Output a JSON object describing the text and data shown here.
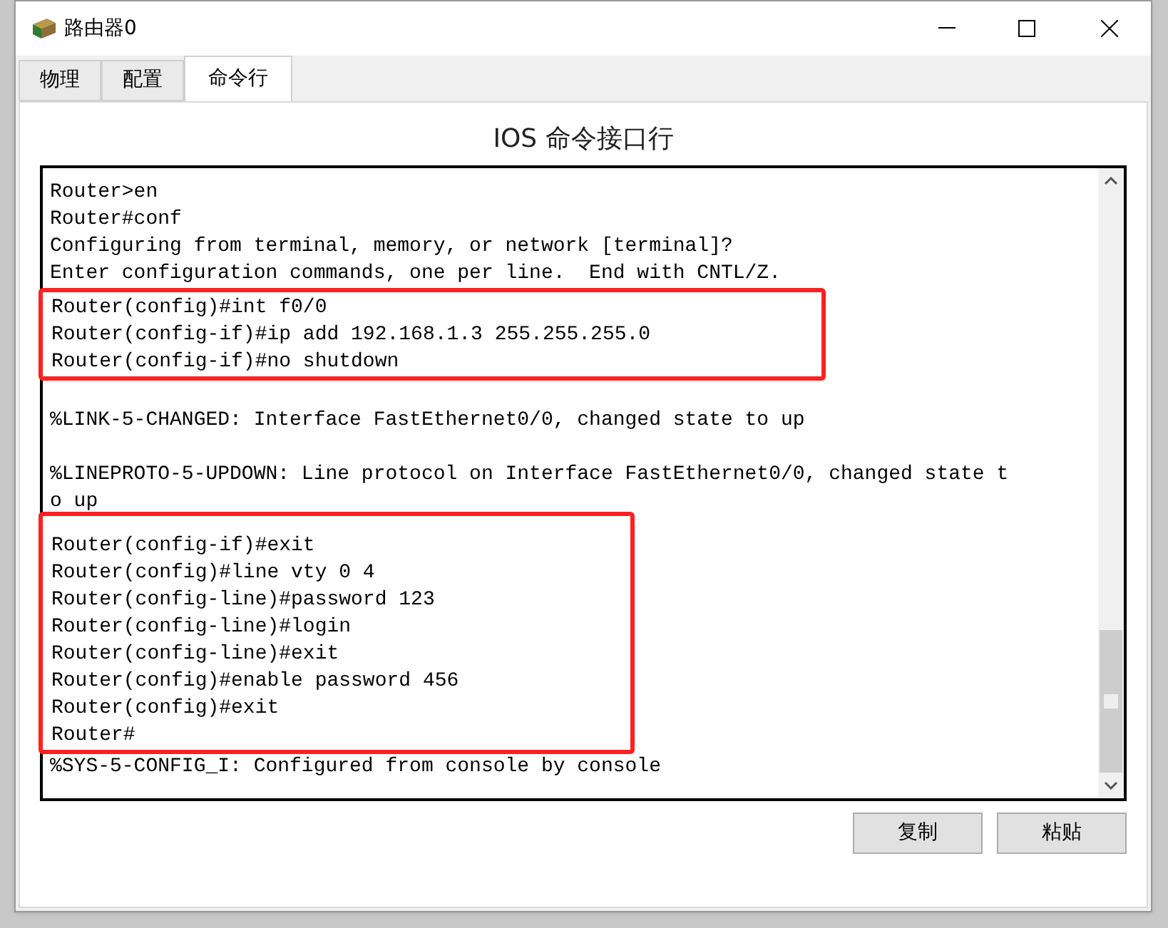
{
  "window": {
    "title": "路由器0"
  },
  "tabs": [
    {
      "label": "物理",
      "selected": false
    },
    {
      "label": "配置",
      "selected": false
    },
    {
      "label": "命令行",
      "selected": true
    }
  ],
  "heading": "IOS 命令接口行",
  "terminal": {
    "blocks": [
      {
        "highlighted": false,
        "gap_before": false,
        "lines": [
          "Router>en",
          "Router#conf",
          "Configuring from terminal, memory, or network [terminal]?",
          "Enter configuration commands, one per line.  End with CNTL/Z."
        ]
      },
      {
        "highlighted": true,
        "gap_before": false,
        "lines": [
          "Router(config)#int f0/0",
          "Router(config-if)#ip add 192.168.1.3 255.255.255.0",
          "Router(config-if)#no shutdown"
        ]
      },
      {
        "highlighted": false,
        "gap_before": true,
        "lines": [
          "%LINK-5-CHANGED: Interface FastEthernet0/0, changed state to up"
        ]
      },
      {
        "highlighted": false,
        "gap_before": true,
        "lines": [
          "%LINEPROTO-5-UPDOWN: Line protocol on Interface FastEthernet0/0, changed state t",
          "o up"
        ]
      },
      {
        "highlighted": true,
        "gap_before": true,
        "lines": [
          "Router(config-if)#exit",
          "Router(config)#line vty 0 4",
          "Router(config-line)#password 123",
          "Router(config-line)#login",
          "Router(config-line)#exit",
          "Router(config)#enable password 456",
          "Router(config)#exit",
          "Router#"
        ]
      },
      {
        "highlighted": false,
        "gap_before": false,
        "lines": [
          "%SYS-5-CONFIG_I: Configured from console by console"
        ]
      }
    ]
  },
  "buttons": [
    "复制",
    "粘贴"
  ]
}
